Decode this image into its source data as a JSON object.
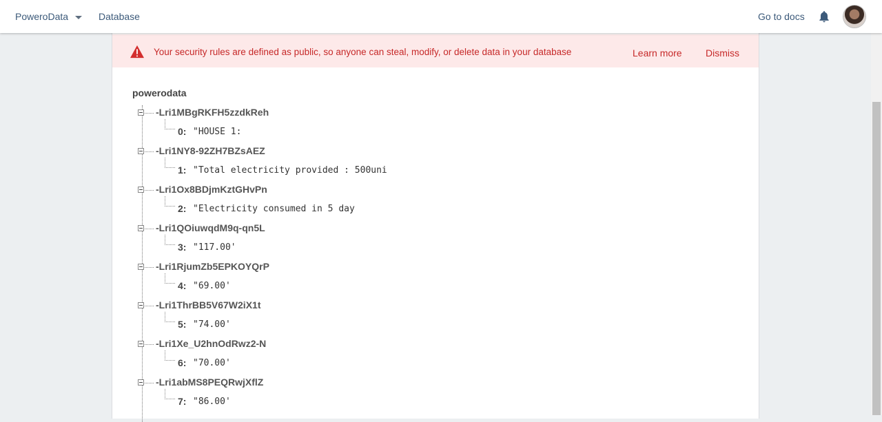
{
  "header": {
    "project": "PoweroData",
    "tab": "Database",
    "docs_link": "Go to docs"
  },
  "banner": {
    "message": "Your security rules are defined as public, so anyone can steal, modify, or delete data in your database",
    "learn_more": "Learn more",
    "dismiss": "Dismiss"
  },
  "tree": {
    "root": "powerodata",
    "nodes": [
      {
        "key": "-Lri1MBgRKFH5zzdkReh",
        "index": "0:",
        "value": "\"HOUSE 1:"
      },
      {
        "key": "-Lri1NY8-92ZH7BZsAEZ",
        "index": "1:",
        "value": "\"Total electricity provided : 500uni"
      },
      {
        "key": "-Lri1Ox8BDjmKztGHvPn",
        "index": "2:",
        "value": "\"Electricity consumed in 5 day"
      },
      {
        "key": "-Lri1QOiuwqdM9q-qn5L",
        "index": "3:",
        "value": "\"117.00'"
      },
      {
        "key": "-Lri1RjumZb5EPKOYQrP",
        "index": "4:",
        "value": "\"69.00'"
      },
      {
        "key": "-Lri1ThrBB5V67W2iX1t",
        "index": "5:",
        "value": "\"74.00'"
      },
      {
        "key": "-Lri1Xe_U2hnOdRwz2-N",
        "index": "6:",
        "value": "\"70.00'"
      },
      {
        "key": "-Lri1abMS8PEQRwjXflZ",
        "index": "7:",
        "value": "\"86.00'"
      }
    ]
  },
  "icons": {
    "dropdown": "chevron-down-icon",
    "notifications": "bell-icon",
    "warning": "warning-icon"
  },
  "colors": {
    "banner_bg": "#fde9e9",
    "banner_text": "#c62828",
    "link": "#3c5a7a"
  }
}
